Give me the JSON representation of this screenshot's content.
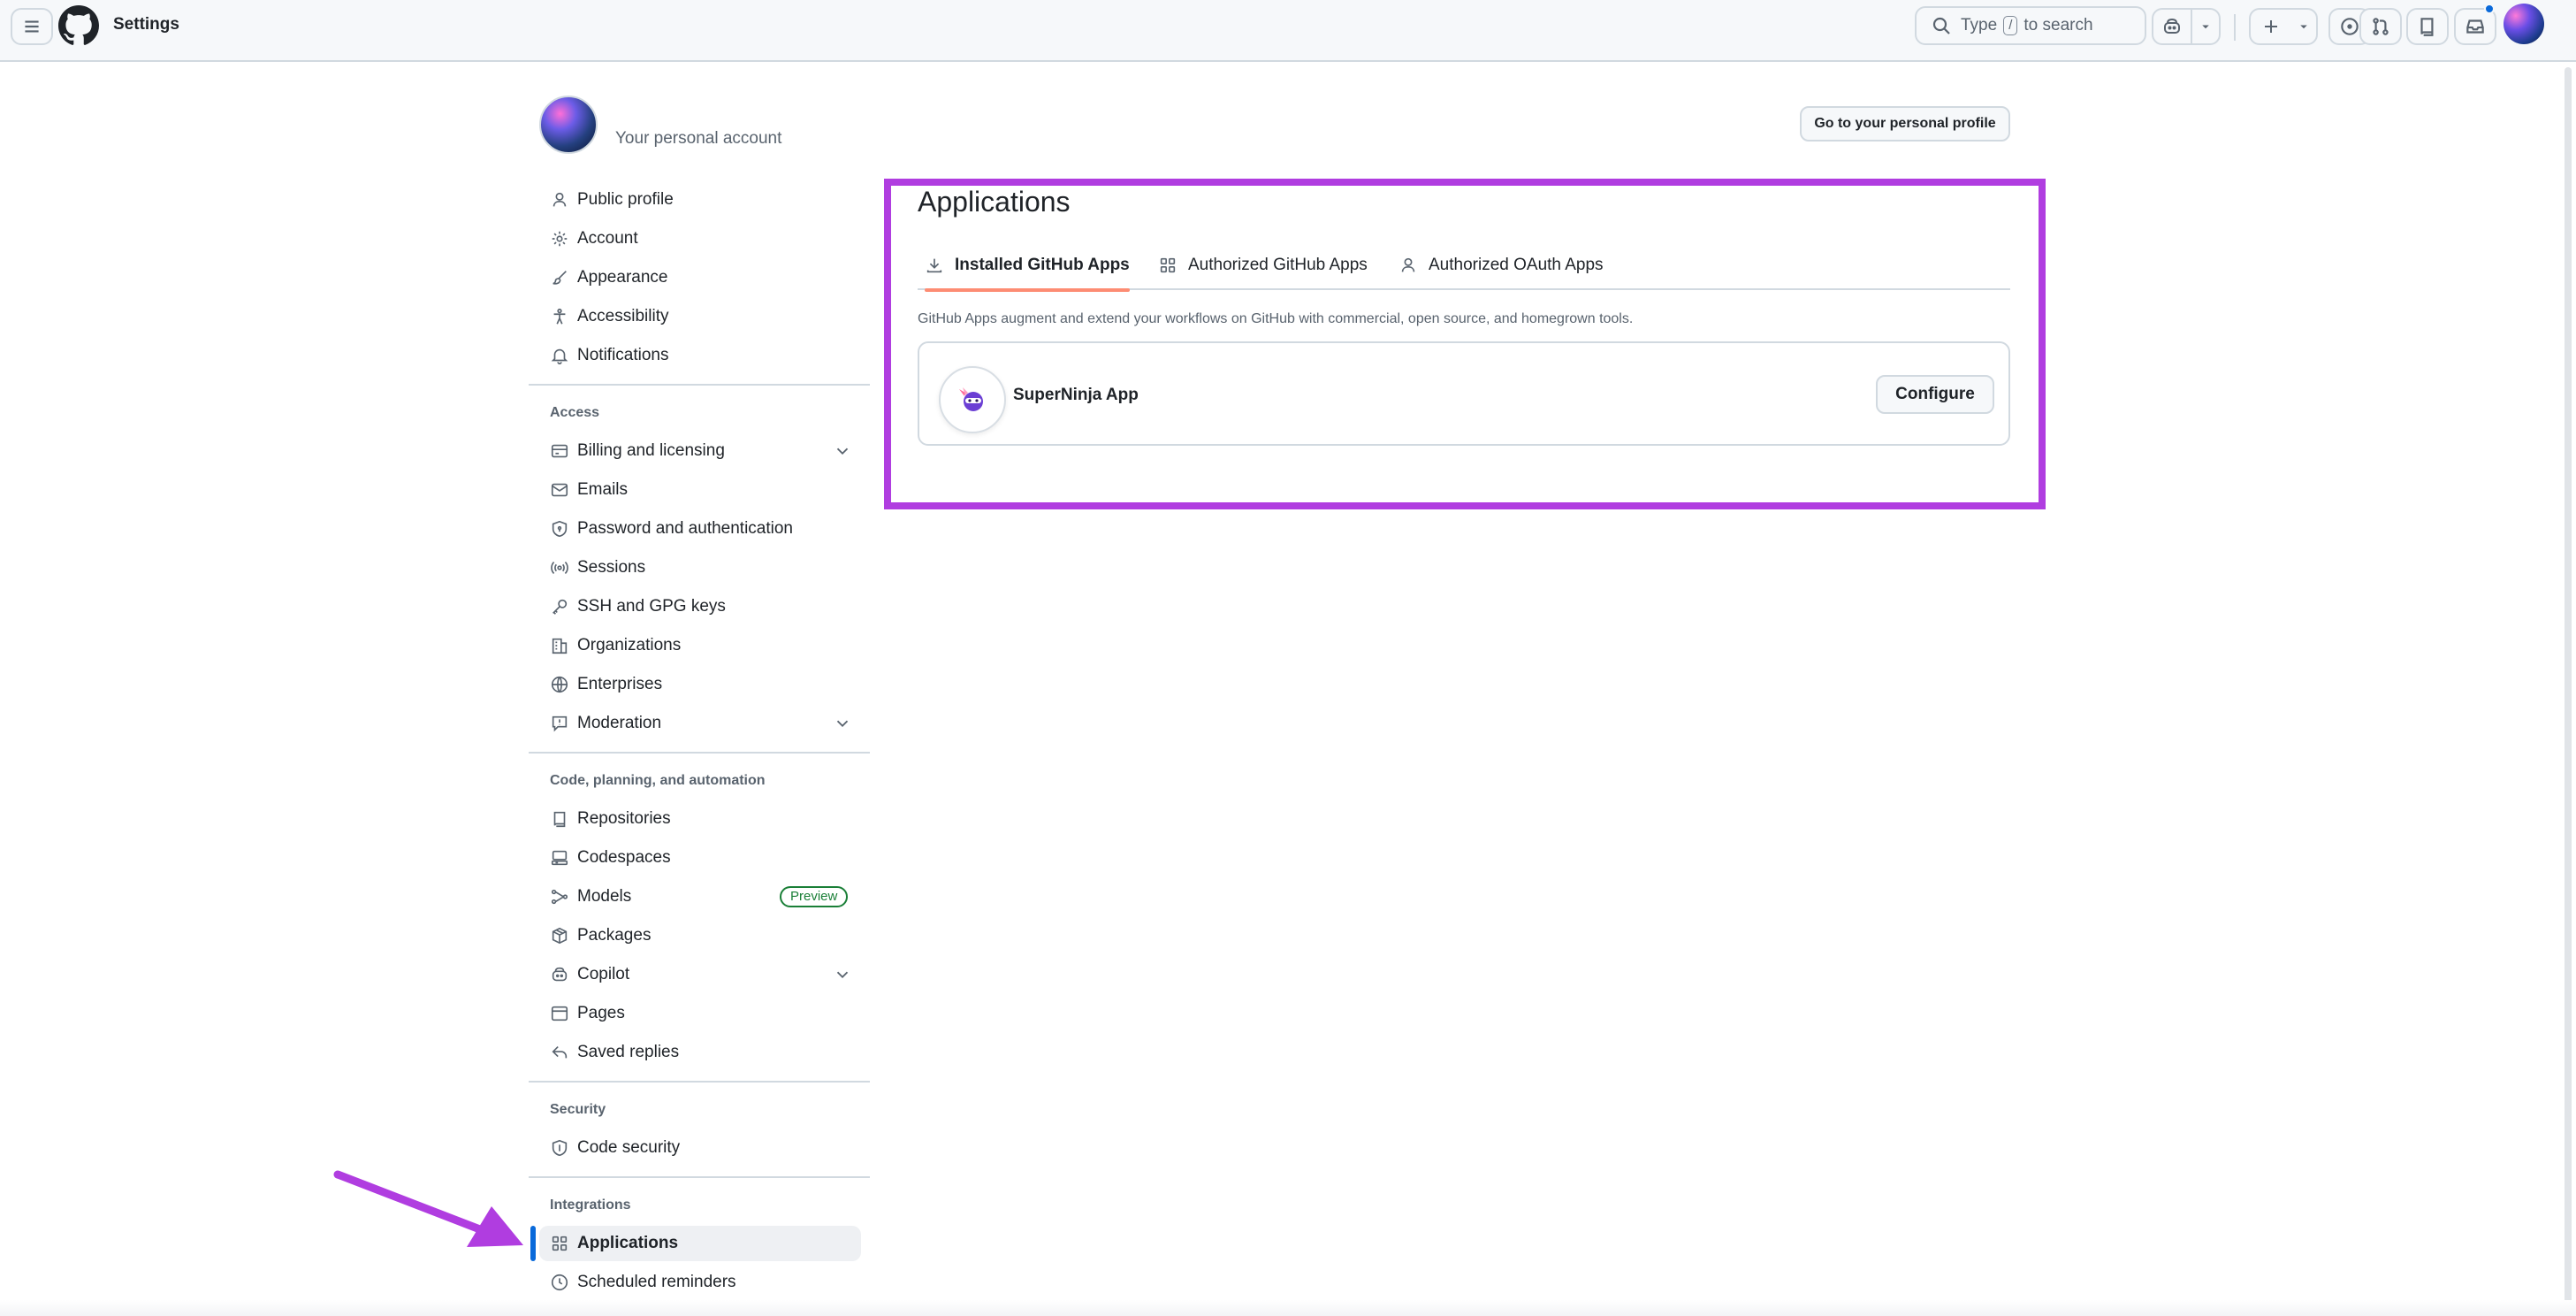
{
  "header": {
    "title": "Settings",
    "search": {
      "prefix": "Type",
      "key": "/",
      "suffix": "to search"
    }
  },
  "account": {
    "label": "Your personal account",
    "profile_button": "Go to your personal profile"
  },
  "sidebar": {
    "top_items": [
      {
        "label": "Public profile",
        "icon": "person-icon"
      },
      {
        "label": "Account",
        "icon": "gear-icon"
      },
      {
        "label": "Appearance",
        "icon": "paintbrush-icon"
      },
      {
        "label": "Accessibility",
        "icon": "accessibility-icon"
      },
      {
        "label": "Notifications",
        "icon": "bell-icon"
      }
    ],
    "groups": [
      {
        "heading": "Access",
        "items": [
          {
            "label": "Billing and licensing",
            "icon": "credit-card-icon",
            "expandable": true
          },
          {
            "label": "Emails",
            "icon": "mail-icon"
          },
          {
            "label": "Password and authentication",
            "icon": "shield-lock-icon"
          },
          {
            "label": "Sessions",
            "icon": "broadcast-icon"
          },
          {
            "label": "SSH and GPG keys",
            "icon": "key-icon"
          },
          {
            "label": "Organizations",
            "icon": "organization-icon"
          },
          {
            "label": "Enterprises",
            "icon": "globe-icon"
          },
          {
            "label": "Moderation",
            "icon": "report-icon",
            "expandable": true
          }
        ]
      },
      {
        "heading": "Code, planning, and automation",
        "items": [
          {
            "label": "Repositories",
            "icon": "repo-icon"
          },
          {
            "label": "Codespaces",
            "icon": "codespaces-icon"
          },
          {
            "label": "Models",
            "icon": "models-icon",
            "badge": "Preview"
          },
          {
            "label": "Packages",
            "icon": "package-icon"
          },
          {
            "label": "Copilot",
            "icon": "copilot-icon",
            "expandable": true
          },
          {
            "label": "Pages",
            "icon": "browser-icon"
          },
          {
            "label": "Saved replies",
            "icon": "reply-icon"
          }
        ]
      },
      {
        "heading": "Security",
        "items": [
          {
            "label": "Code security",
            "icon": "shield-icon"
          }
        ]
      },
      {
        "heading": "Integrations",
        "items": [
          {
            "label": "Applications",
            "icon": "apps-icon",
            "active": true
          },
          {
            "label": "Scheduled reminders",
            "icon": "clock-icon"
          }
        ]
      }
    ]
  },
  "main": {
    "title": "Applications",
    "tabs": [
      {
        "label": "Installed GitHub Apps",
        "icon": "download-icon",
        "selected": true
      },
      {
        "label": "Authorized GitHub Apps",
        "icon": "apps-icon"
      },
      {
        "label": "Authorized OAuth Apps",
        "icon": "person-icon"
      }
    ],
    "description": "GitHub Apps augment and extend your workflows on GitHub with commercial, open source, and homegrown tools.",
    "apps": [
      {
        "name": "SuperNinja App",
        "action": "Configure"
      }
    ]
  },
  "colors": {
    "accent_blue": "#0969da",
    "tab_underline": "#fd8c73",
    "preview_green": "#1a7f37",
    "annotation_purple": "#b03de0"
  }
}
